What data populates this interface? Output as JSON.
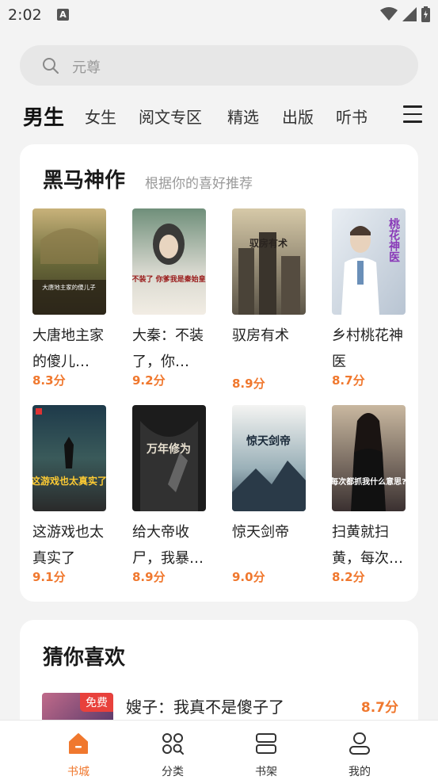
{
  "status": {
    "time": "2:02"
  },
  "search": {
    "placeholder": "元尊"
  },
  "tabs": [
    {
      "label": "男生",
      "active": true
    },
    {
      "label": "女生"
    },
    {
      "label": "阅文专区"
    },
    {
      "label": "精选"
    },
    {
      "label": "出版"
    },
    {
      "label": "听书"
    }
  ],
  "recommend": {
    "title": "黑马神作",
    "subtitle": "根据你的喜好推荐",
    "books": [
      {
        "title": "大唐地主家的傻儿…",
        "score": "8.3分",
        "cover_text": "大唐地主家的傻儿子"
      },
      {
        "title": "大秦：不装了，你…",
        "score": "9.2分",
        "cover_text": "不装了 你爹我是秦始皇"
      },
      {
        "title": "驭房有术",
        "score": "8.9分",
        "cover_text": "驭房有术"
      },
      {
        "title": "乡村桃花神医",
        "score": "8.7分",
        "cover_text": "桃花神医"
      },
      {
        "title": "这游戏也太真实了",
        "score": "9.1分",
        "cover_text": "这游戏也太真实了"
      },
      {
        "title": "给大帝收尸，我暴…",
        "score": "8.9分",
        "cover_text": "万年修为"
      },
      {
        "title": "惊天剑帝",
        "score": "9.0分",
        "cover_text": "惊天剑帝"
      },
      {
        "title": "扫黄就扫黄，每次…",
        "score": "8.2分",
        "cover_text": "每次都抓我什么意思?"
      }
    ]
  },
  "guess": {
    "title": "猜你喜欢",
    "item": {
      "title": "嫂子：我真不是傻子了",
      "score": "8.7分",
      "badge": "免费"
    }
  },
  "nav": [
    {
      "label": "书城",
      "icon": "home-icon",
      "active": true
    },
    {
      "label": "分类",
      "icon": "category-icon"
    },
    {
      "label": "书架",
      "icon": "bookshelf-icon"
    },
    {
      "label": "我的",
      "icon": "profile-icon"
    }
  ],
  "colors": {
    "accent": "#f0782e",
    "background": "#f3f3f3",
    "card": "#ffffff"
  }
}
